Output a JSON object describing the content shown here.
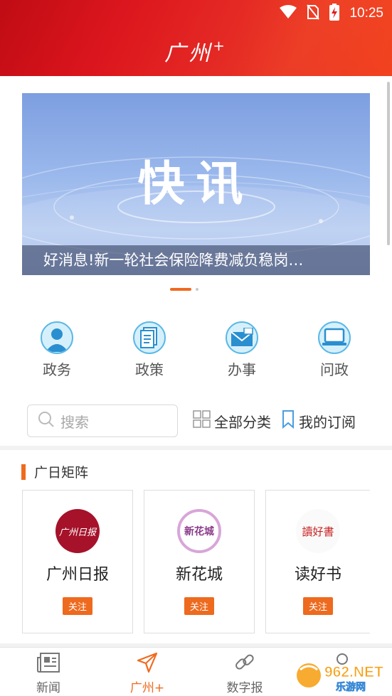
{
  "status_bar": {
    "time": "10:25"
  },
  "header": {
    "app_name": "广州",
    "app_suffix": "+"
  },
  "banner": {
    "title": "快讯",
    "caption": "好消息!新一轮社会保险降费减负稳岗…",
    "slide_count": 2,
    "active_slide": 1
  },
  "quick_links": [
    {
      "label": "政务",
      "icon": "person-icon"
    },
    {
      "label": "政策",
      "icon": "document-icon"
    },
    {
      "label": "办事",
      "icon": "envelope-icon"
    },
    {
      "label": "问政",
      "icon": "laptop-icon"
    }
  ],
  "search": {
    "placeholder": "搜索"
  },
  "filters": {
    "all_categories": "全部分类",
    "my_subscriptions": "我的订阅"
  },
  "matrix": {
    "title": "广日矩阵",
    "cards": [
      {
        "name": "广州日报",
        "logo_text": "广州日报",
        "follow": "关注"
      },
      {
        "name": "新花城",
        "logo_text": "新花城",
        "follow": "关注"
      },
      {
        "name": "读好书",
        "logo_text": "讀好書",
        "follow": "关注"
      }
    ]
  },
  "bottom_nav": [
    {
      "label": "新闻",
      "active": false
    },
    {
      "label": "广州+",
      "active": true
    },
    {
      "label": "数字报",
      "active": false
    },
    {
      "label": "",
      "active": false
    }
  ],
  "watermark": {
    "text": "962.NET",
    "subtext": "乐游网"
  },
  "colors": {
    "header_red": "#e01c20",
    "accent_orange": "#f06a1e",
    "icon_blue": "#5ab8e6"
  }
}
